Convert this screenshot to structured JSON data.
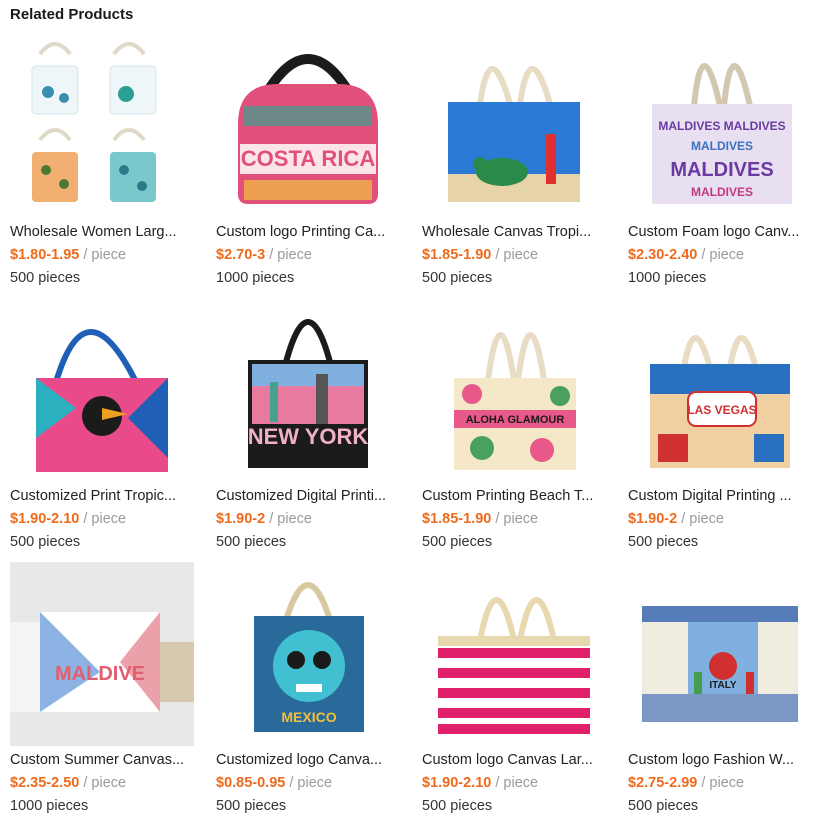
{
  "section": {
    "title": "Related Products"
  },
  "products": [
    {
      "title": "Wholesale Women Larg...",
      "price": "$1.80-1.95",
      "unit": "/ piece",
      "moq": "500 pieces",
      "image": "turtle-tote-bags",
      "colors": [
        "#e8f3f7",
        "#f1b072",
        "#78c8cc"
      ]
    },
    {
      "title": "Custom logo Printing Ca...",
      "price": "$2.70-3",
      "unit": "/ piece",
      "moq": "1000 pieces",
      "image": "costa-rica-hobo-bag",
      "colors": [
        "#e0507a",
        "#2d9a8a",
        "#1b1b1b"
      ]
    },
    {
      "title": "Wholesale Canvas Tropi...",
      "price": "$1.85-1.90",
      "unit": "/ piece",
      "moq": "500 pieces",
      "image": "sea-turtle-rope-tote",
      "colors": [
        "#2b7bd6",
        "#e7d3a8",
        "#2a8a4a"
      ]
    },
    {
      "title": "Custom Foam logo Canv...",
      "price": "$2.30-2.40",
      "unit": "/ piece",
      "moq": "1000 pieces",
      "image": "maldives-text-tote",
      "colors": [
        "#6b3aa0",
        "#e8e0f0",
        "#d4c7b0"
      ]
    },
    {
      "title": "Customized Print Tropic...",
      "price": "$1.90-2.10",
      "unit": "/ piece",
      "moq": "500 pieces",
      "image": "toucan-tropical-tote",
      "colors": [
        "#1f5fb5",
        "#e84a8a",
        "#2bb0c0"
      ]
    },
    {
      "title": "Customized Digital Printi...",
      "price": "$1.90-2",
      "unit": "/ piece",
      "moq": "500 pieces",
      "image": "new-york-tote",
      "colors": [
        "#1b1b1b",
        "#e87aa0",
        "#7fb0e0"
      ]
    },
    {
      "title": "Custom Printing Beach T...",
      "price": "$1.85-1.90",
      "unit": "/ piece",
      "moq": "500 pieces",
      "image": "aloha-glamour-tote",
      "colors": [
        "#e8588a",
        "#4aa060",
        "#f4e8c8"
      ]
    },
    {
      "title": "Custom Digital Printing ...",
      "price": "$1.90-2",
      "unit": "/ piece",
      "moq": "500 pieces",
      "image": "las-vegas-tote",
      "colors": [
        "#d03030",
        "#2a70c0",
        "#f0d0a0"
      ]
    },
    {
      "title": "Custom Summer Canvas...",
      "price": "$2.35-2.50",
      "unit": "/ piece",
      "moq": "1000 pieces",
      "image": "maldive-summer-tote",
      "colors": [
        "#e8e8e8",
        "#e06070",
        "#4080d0"
      ]
    },
    {
      "title": "Customized logo Canva...",
      "price": "$0.85-0.95",
      "unit": "/ piece",
      "moq": "500 pieces",
      "image": "sugar-skull-tote",
      "colors": [
        "#2a6a9a",
        "#40c0d0",
        "#d8c8a0"
      ]
    },
    {
      "title": "Custom logo Canvas Lar...",
      "price": "$1.90-2.10",
      "unit": "/ piece",
      "moq": "500 pieces",
      "image": "pink-striped-tote",
      "colors": [
        "#e0206a",
        "#ffffff",
        "#e8d8b0"
      ]
    },
    {
      "title": "Custom logo Fashion W...",
      "price": "$2.75-2.99",
      "unit": "/ piece",
      "moq": "500 pieces",
      "image": "italy-scooter-tote",
      "colors": [
        "#f0ece0",
        "#3060b0",
        "#40a050"
      ]
    }
  ]
}
